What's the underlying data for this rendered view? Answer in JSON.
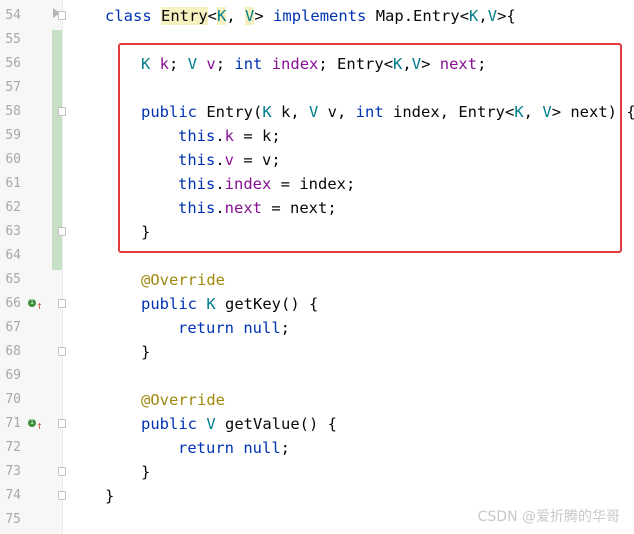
{
  "editor": {
    "lines": [
      {
        "num": "54",
        "segs": [
          [
            "class ",
            "kw"
          ],
          [
            "Entry",
            "hl"
          ],
          [
            "<",
            ""
          ],
          [
            "K",
            "tp hl"
          ],
          [
            ", ",
            ""
          ],
          [
            "V",
            "tp hl"
          ],
          [
            "> ",
            ""
          ],
          [
            "implements ",
            "kw"
          ],
          [
            "Map.Entry<",
            ""
          ],
          [
            "K",
            "tp"
          ],
          [
            ",",
            ""
          ],
          [
            "V",
            "tp"
          ],
          [
            ">{",
            ""
          ]
        ]
      },
      {
        "num": "55",
        "segs": []
      },
      {
        "num": "56",
        "segs": [
          [
            "K ",
            "tp"
          ],
          [
            "k",
            "fd"
          ],
          [
            "; ",
            ""
          ],
          [
            "V ",
            "tp"
          ],
          [
            "v",
            "fd"
          ],
          [
            "; ",
            ""
          ],
          [
            "int ",
            "kw"
          ],
          [
            "index",
            "fd"
          ],
          [
            "; Entry<",
            ""
          ],
          [
            "K",
            "tp"
          ],
          [
            ",",
            ""
          ],
          [
            "V",
            "tp"
          ],
          [
            "> ",
            ""
          ],
          [
            "next",
            "fd"
          ],
          [
            ";",
            ""
          ]
        ]
      },
      {
        "num": "57",
        "segs": []
      },
      {
        "num": "58",
        "segs": [
          [
            "public ",
            "kw"
          ],
          [
            "Entry(",
            ""
          ],
          [
            "K ",
            "tp"
          ],
          [
            "k, ",
            ""
          ],
          [
            "V ",
            "tp"
          ],
          [
            "v, ",
            ""
          ],
          [
            "int ",
            "kw"
          ],
          [
            "index, Entry<",
            ""
          ],
          [
            "K",
            "tp"
          ],
          [
            ", ",
            ""
          ],
          [
            "V",
            "tp"
          ],
          [
            "> next) {",
            ""
          ]
        ]
      },
      {
        "num": "59",
        "segs": [
          [
            "this",
            "kw"
          ],
          [
            ".",
            ""
          ],
          [
            "k",
            "fd"
          ],
          [
            " = k;",
            ""
          ]
        ]
      },
      {
        "num": "60",
        "segs": [
          [
            "this",
            "kw"
          ],
          [
            ".",
            ""
          ],
          [
            "v",
            "fd"
          ],
          [
            " = v;",
            ""
          ]
        ]
      },
      {
        "num": "61",
        "segs": [
          [
            "this",
            "kw"
          ],
          [
            ".",
            ""
          ],
          [
            "index",
            "fd"
          ],
          [
            " = index;",
            ""
          ]
        ]
      },
      {
        "num": "62",
        "segs": [
          [
            "this",
            "kw"
          ],
          [
            ".",
            ""
          ],
          [
            "next",
            "fd"
          ],
          [
            " = next;",
            ""
          ]
        ]
      },
      {
        "num": "63",
        "segs": [
          [
            "}",
            ""
          ]
        ]
      },
      {
        "num": "64",
        "segs": []
      },
      {
        "num": "65",
        "segs": [
          [
            "@Override",
            "an"
          ]
        ]
      },
      {
        "num": "66",
        "segs": [
          [
            "public ",
            "kw"
          ],
          [
            "K ",
            "tp"
          ],
          [
            "getKey() {",
            ""
          ]
        ]
      },
      {
        "num": "67",
        "segs": [
          [
            "return null",
            "kw"
          ],
          [
            ";",
            ""
          ]
        ]
      },
      {
        "num": "68",
        "segs": [
          [
            "}",
            ""
          ]
        ]
      },
      {
        "num": "69",
        "segs": []
      },
      {
        "num": "70",
        "segs": [
          [
            "@Override",
            "an"
          ]
        ]
      },
      {
        "num": "71",
        "segs": [
          [
            "public ",
            "kw"
          ],
          [
            "V ",
            "tp"
          ],
          [
            "getValue() {",
            ""
          ]
        ]
      },
      {
        "num": "72",
        "segs": [
          [
            "return null",
            "kw"
          ],
          [
            ";",
            ""
          ]
        ]
      },
      {
        "num": "73",
        "segs": [
          [
            "}",
            ""
          ]
        ]
      },
      {
        "num": "74",
        "segs": [
          [
            "}",
            ""
          ]
        ]
      },
      {
        "num": "75",
        "segs": []
      }
    ]
  },
  "watermark": "CSDN @爱折腾的华哥",
  "colors": {
    "keyword": "#0033b3",
    "type_param": "#007e8a",
    "field": "#871094",
    "annotation": "#9e880d",
    "highlight_box": "#e23d3d"
  }
}
